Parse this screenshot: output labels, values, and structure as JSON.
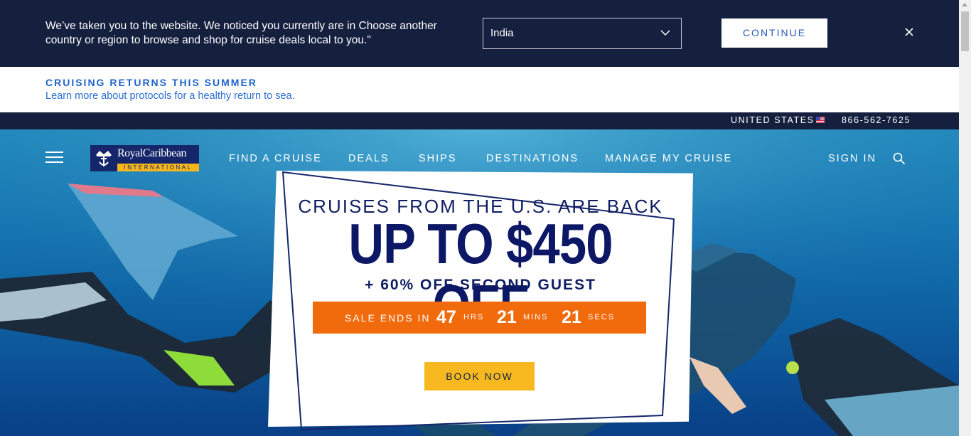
{
  "geo_banner": {
    "message": "We’ve taken you to the website. We noticed you currently are in Choose another country or region to browse and shop for cruise deals local to you.\"",
    "selected_country": "India",
    "continue_label": "CONTINUE"
  },
  "announcement": {
    "title": "CRUISING RETURNS THIS SUMMER",
    "link": "Learn more about protocols for a healthy return to sea."
  },
  "utility_bar": {
    "country": "UNITED STATES",
    "phone": "866-562-7625"
  },
  "nav": {
    "logo_name": "RoyalCaribbean",
    "logo_sub": "INTERNATIONAL",
    "items": [
      "FIND A CRUISE",
      "DEALS",
      "SHIPS",
      "DESTINATIONS",
      "MANAGE MY CRUISE"
    ],
    "sign_in": "SIGN IN"
  },
  "promo": {
    "kicker": "CRUISES FROM THE U.S. ARE BACK",
    "headline": "UP TO $450 OFF",
    "sub": "+ 60% OFF SECOND GUEST",
    "countdown": {
      "label": "SALE ENDS IN",
      "hours": "47",
      "hours_unit": "HRS",
      "mins": "21",
      "mins_unit": "MINS",
      "secs": "21",
      "secs_unit": "SECS"
    },
    "cta": "BOOK NOW"
  },
  "colors": {
    "navy": "#15203f",
    "accent_blue": "#1d63c9",
    "orange": "#f16a0c",
    "yellow": "#f7b820"
  }
}
